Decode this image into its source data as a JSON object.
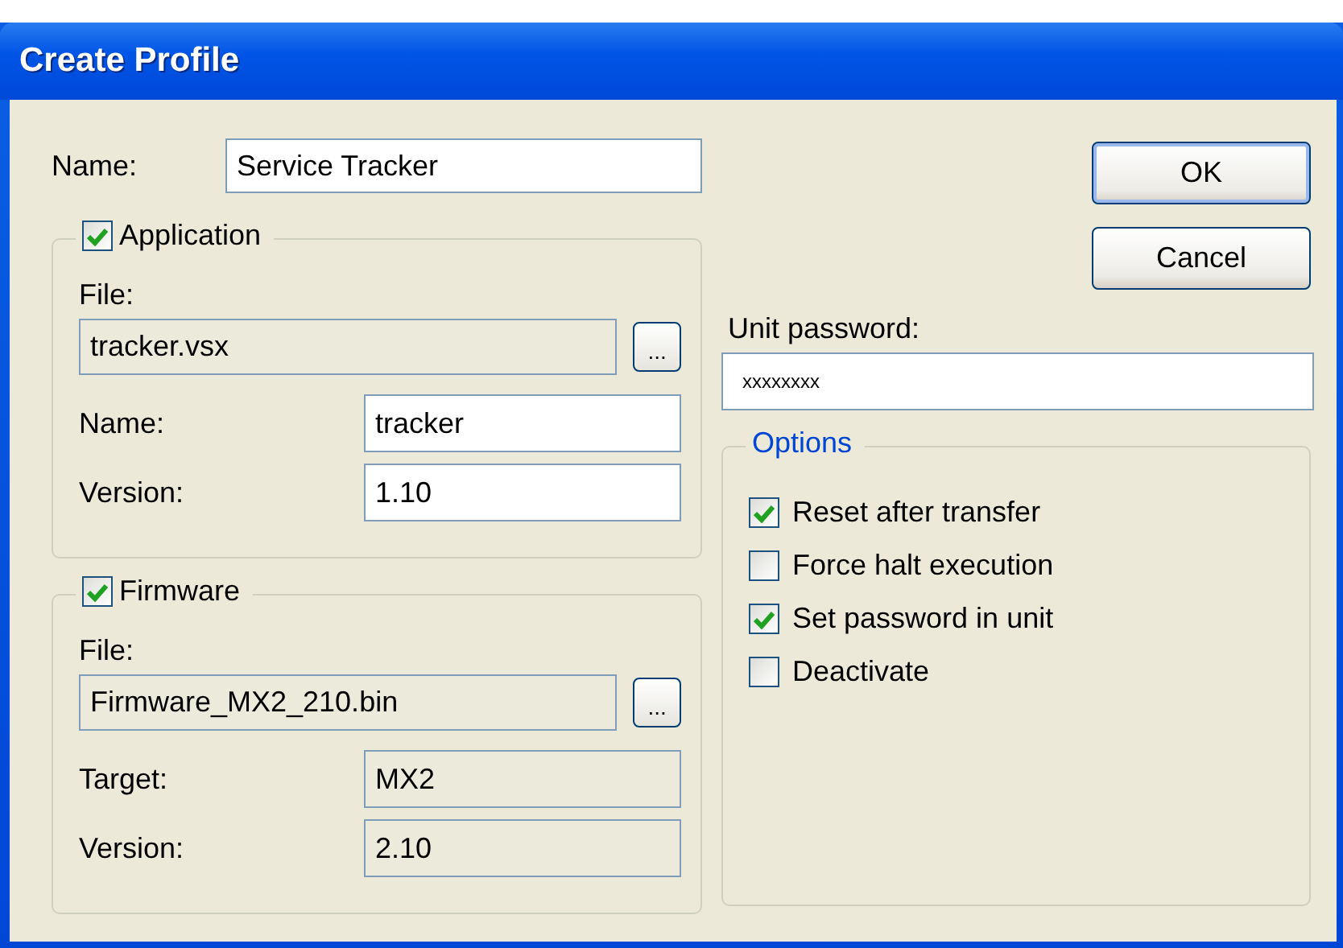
{
  "window": {
    "title": "Create Profile"
  },
  "name_field": {
    "label": "Name:",
    "value": "Service Tracker"
  },
  "groups": [
    {
      "title": "Application",
      "checked": true,
      "file_label": "File:",
      "file": {
        "value": "tracker.vsx",
        "disabled": true
      },
      "browse_button": "...",
      "fields": [
        {
          "label": "Name:",
          "value": "tracker",
          "disabled": false
        },
        {
          "label": "Version:",
          "value": "1.10",
          "disabled": false
        }
      ]
    },
    {
      "title": "Firmware",
      "checked": true,
      "file_label": "File:",
      "file": {
        "value": "Firmware_MX2_210.bin",
        "disabled": true
      },
      "browse_button": "...",
      "fields": [
        {
          "label": "Target:",
          "value": "MX2",
          "disabled": true
        },
        {
          "label": "Version:",
          "value": "2.10",
          "disabled": true
        }
      ]
    }
  ],
  "buttons": [
    {
      "label": "OK",
      "default": true
    },
    {
      "label": "Cancel",
      "default": false
    }
  ],
  "password": {
    "label": "Unit password:",
    "value": "xxxxxxxx"
  },
  "options": {
    "title": "Options",
    "items": [
      {
        "label": "Reset after transfer",
        "checked": true
      },
      {
        "label": "Force halt execution",
        "checked": false
      },
      {
        "label": "Set password in unit",
        "checked": true
      },
      {
        "label": "Deactivate",
        "checked": false
      }
    ]
  }
}
